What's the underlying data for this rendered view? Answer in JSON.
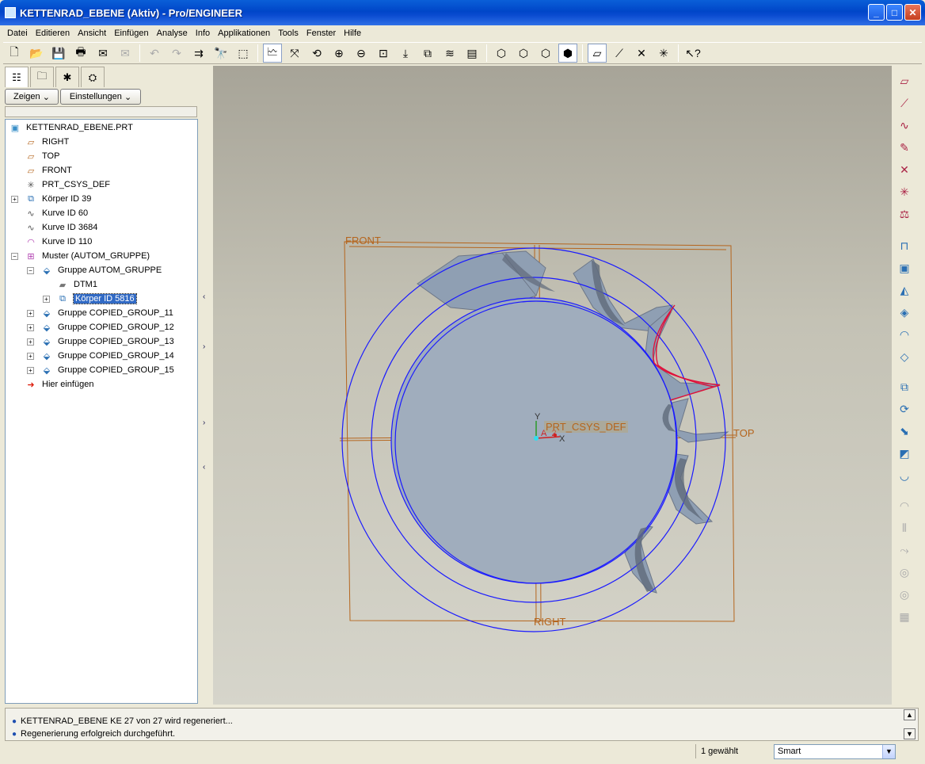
{
  "window": {
    "title": "KETTENRAD_EBENE (Aktiv) - Pro/ENGINEER",
    "buttons": {
      "minimize": "_",
      "maximize": "□",
      "close": "✕"
    }
  },
  "menu": [
    "Datei",
    "Editieren",
    "Ansicht",
    "Einfügen",
    "Analyse",
    "Info",
    "Applikationen",
    "Tools",
    "Fenster",
    "Hilfe"
  ],
  "left_panel": {
    "show_button": "Zeigen",
    "settings_button": "Einstellungen",
    "tree": [
      {
        "label": "KETTENRAD_EBENE.PRT",
        "icon": "part-icon"
      },
      {
        "label": "RIGHT",
        "icon": "datum-plane-icon"
      },
      {
        "label": "TOP",
        "icon": "datum-plane-icon"
      },
      {
        "label": "FRONT",
        "icon": "datum-plane-icon"
      },
      {
        "label": "PRT_CSYS_DEF",
        "icon": "csys-icon"
      },
      {
        "label": "Körper ID 39",
        "icon": "body-icon"
      },
      {
        "label": "Kurve ID 60",
        "icon": "curve-icon"
      },
      {
        "label": "Kurve ID 3684",
        "icon": "curve-icon"
      },
      {
        "label": "Kurve ID 110",
        "icon": "curve-icon"
      },
      {
        "label": "Muster (AUTOM_GRUPPE)",
        "icon": "pattern-icon"
      },
      {
        "label": "Gruppe AUTOM_GRUPPE",
        "icon": "group-icon"
      },
      {
        "label": "DTM1",
        "icon": "datum-plane-icon"
      },
      {
        "label": "Körper ID 5816",
        "icon": "body-icon"
      },
      {
        "label": "Gruppe COPIED_GROUP_11",
        "icon": "group-icon"
      },
      {
        "label": "Gruppe COPIED_GROUP_12",
        "icon": "group-icon"
      },
      {
        "label": "Gruppe COPIED_GROUP_13",
        "icon": "group-icon"
      },
      {
        "label": "Gruppe COPIED_GROUP_14",
        "icon": "group-icon"
      },
      {
        "label": "Gruppe COPIED_GROUP_15",
        "icon": "group-icon"
      },
      {
        "label": "Hier einfügen",
        "icon": "insert-arrow-icon"
      }
    ]
  },
  "viewport": {
    "labels": {
      "front": "FRONT",
      "top": "TOP",
      "right": "RIGHT",
      "csys": "PRT_CSYS_DEF",
      "axis_y": "Y",
      "axis_x": "X",
      "axis_a": "A_2"
    },
    "colors": {
      "datum": "#b5651d",
      "circle": "#1a1aff",
      "highlight": "#e0103a",
      "solid": "#8f9fb3"
    }
  },
  "messages": [
    "KETTENRAD_EBENE KE 27 von 27 wird regeneriert...",
    "Regenerierung erfolgreich durchgeführt."
  ],
  "status": {
    "selection_count": "1 gewählt",
    "filter_value": "Smart"
  }
}
